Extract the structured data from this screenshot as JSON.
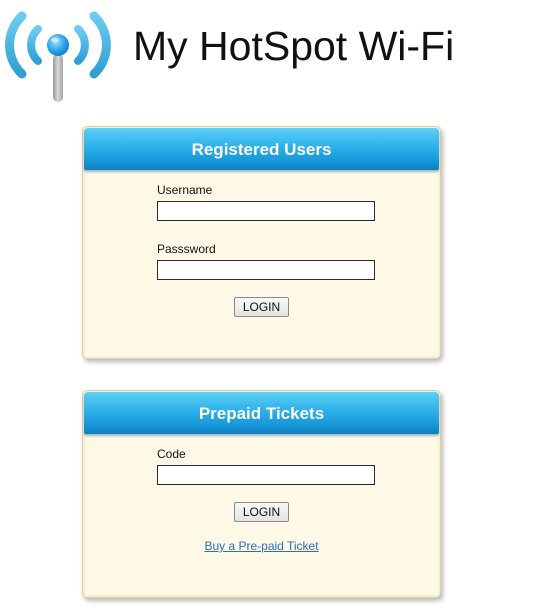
{
  "header": {
    "title": "My HotSpot Wi-Fi",
    "logo_icon": "wifi-signal-logo"
  },
  "colors": {
    "header_gradient_top": "#5fd0f6",
    "header_gradient_bottom": "#0f7fc0",
    "panel_background": "#fdf9e6",
    "link": "#2a6fb7"
  },
  "registered_users": {
    "title": "Registered Users",
    "username_label": "Username",
    "username_value": "",
    "password_label": "Passsword",
    "password_value": "",
    "login_label": "LOGIN"
  },
  "prepaid_tickets": {
    "title": "Prepaid Tickets",
    "code_label": "Code",
    "code_value": "",
    "login_label": "LOGIN",
    "buy_link": "Buy a Pre-paid Ticket"
  }
}
